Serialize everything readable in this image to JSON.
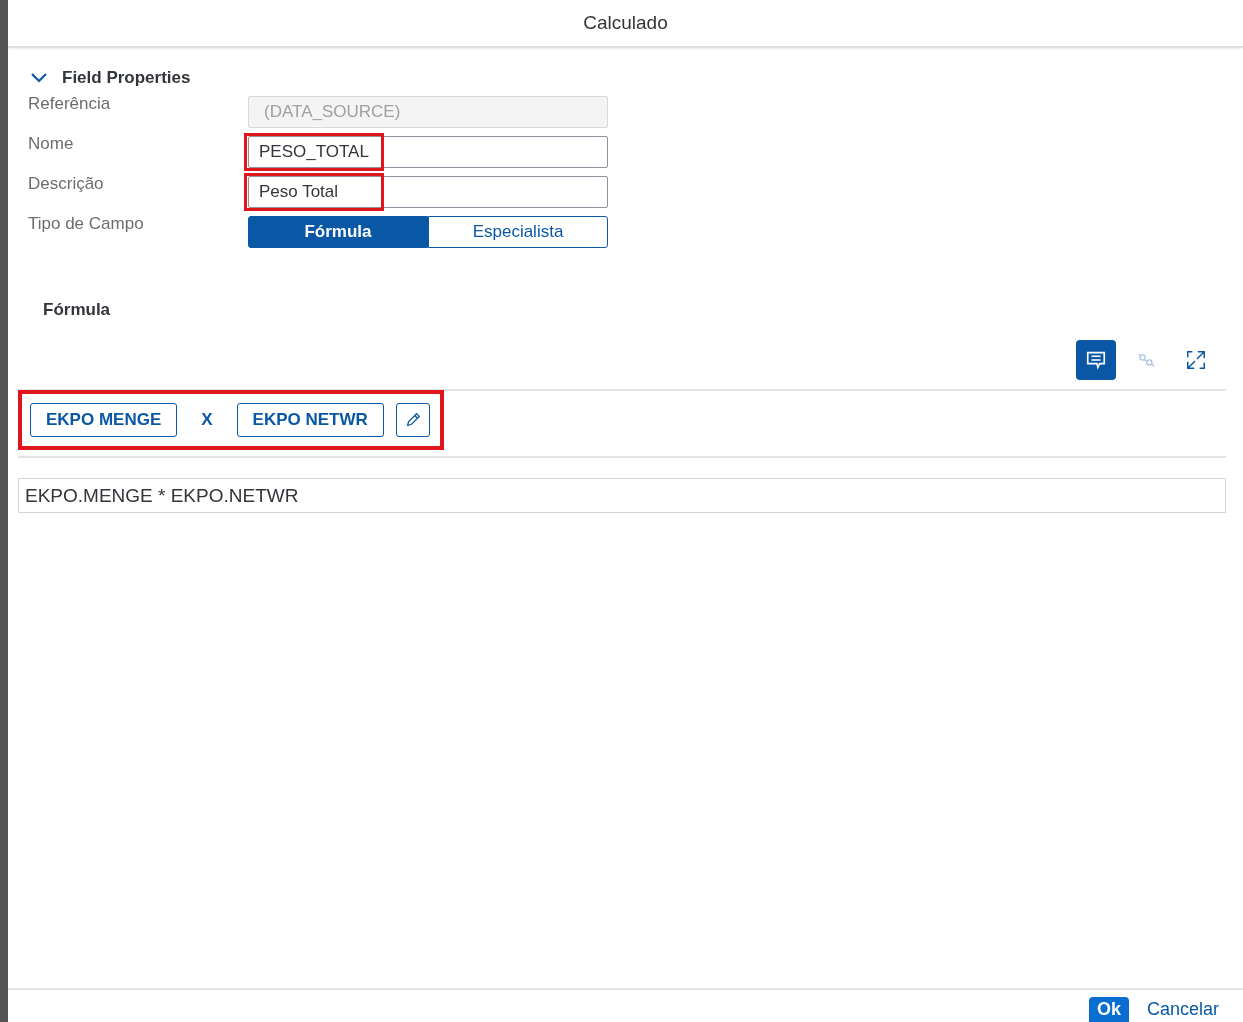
{
  "dialog": {
    "title": "Calculado"
  },
  "field_properties": {
    "title": "Field Properties",
    "expanded": true,
    "rows": [
      {
        "label": "Referência",
        "kind": "input",
        "value": "(DATA_SOURCE)",
        "disabled": true
      },
      {
        "label": "Nome",
        "kind": "input",
        "value": "PESO_TOTAL",
        "disabled": false,
        "highlighted": true
      },
      {
        "label": "Descrição",
        "kind": "input",
        "value": "Peso Total",
        "disabled": false,
        "highlighted": true
      },
      {
        "label": "Tipo de Campo",
        "kind": "segmented",
        "options": [
          {
            "label": "Fórmula",
            "selected": true
          },
          {
            "label": "Especialista",
            "selected": false
          }
        ]
      }
    ]
  },
  "formula": {
    "title": "Fórmula",
    "toolbar": [
      {
        "kind": "comment",
        "selected": true,
        "disabled": false
      },
      {
        "kind": "unlink",
        "selected": false,
        "disabled": true
      },
      {
        "kind": "expand",
        "selected": false,
        "disabled": false
      }
    ],
    "tokens_highlighted": true,
    "tokens": [
      {
        "kind": "field",
        "text": "EKPO MENGE"
      },
      {
        "kind": "operator",
        "text": "X"
      },
      {
        "kind": "field",
        "text": "EKPO NETWR"
      },
      {
        "kind": "edit"
      }
    ],
    "expression": "EKPO.MENGE * EKPO.NETWR"
  },
  "footer": {
    "buttons": [
      {
        "label": "Ok",
        "kind": "emphasized"
      },
      {
        "label": "Cancelar",
        "kind": "transparent"
      }
    ]
  }
}
